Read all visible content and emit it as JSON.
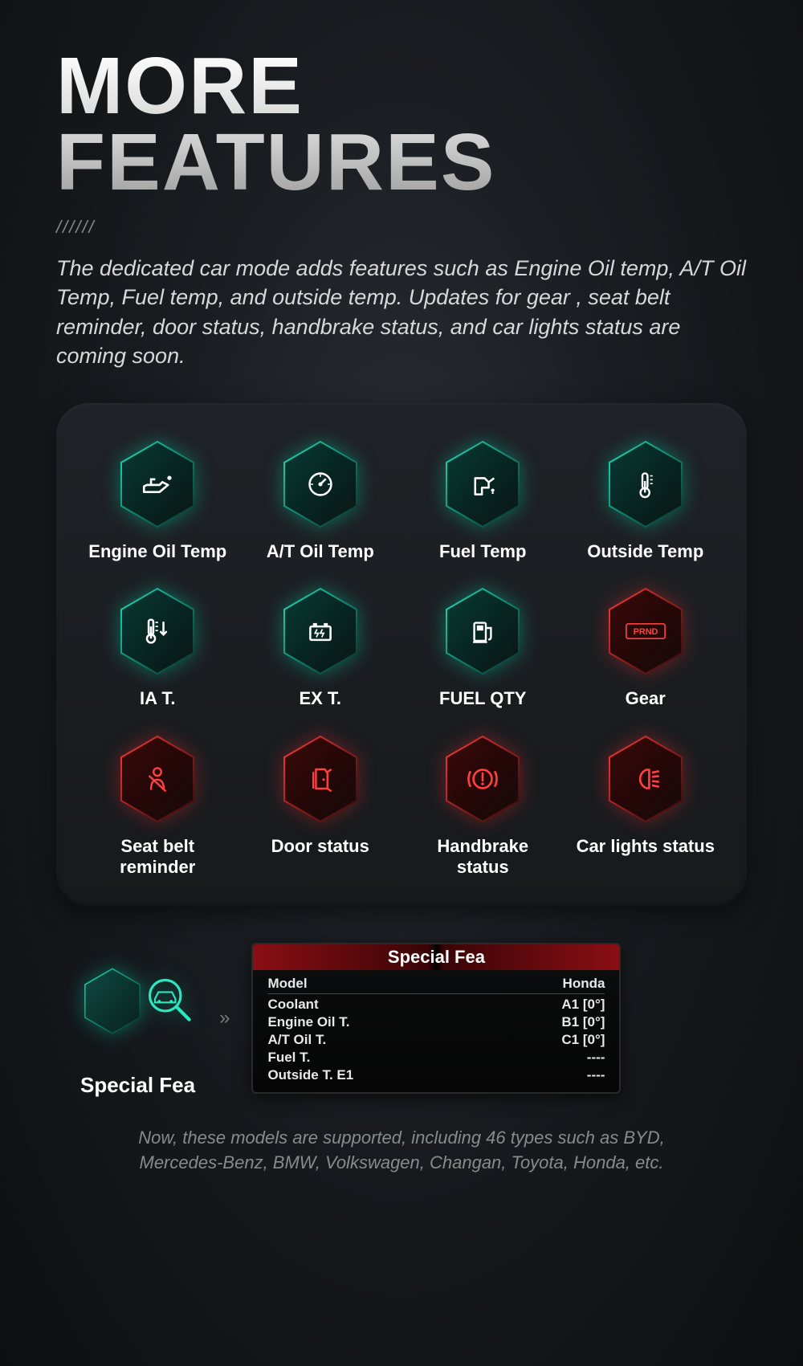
{
  "title_line1": "MORE",
  "title_line2": "FEATURES",
  "slashes": "//////",
  "description": "The dedicated car mode adds features such as Engine Oil temp, A/T Oil Temp, Fuel temp, and outside temp. Updates for gear , seat belt reminder, door status, handbrake status, and car lights status are coming soon.",
  "tiles": [
    {
      "label": "Engine Oil Temp",
      "color": "teal",
      "icon": "oil-can"
    },
    {
      "label": "A/T Oil Temp",
      "color": "teal",
      "icon": "gauge"
    },
    {
      "label": "Fuel Temp",
      "color": "teal",
      "icon": "fuel-nozzle"
    },
    {
      "label": "Outside Temp",
      "color": "teal",
      "icon": "thermometer"
    },
    {
      "label": "IA T.",
      "color": "teal",
      "icon": "intake-temp"
    },
    {
      "label": "EX T.",
      "color": "teal",
      "icon": "battery-temp"
    },
    {
      "label": "FUEL QTY",
      "color": "teal",
      "icon": "fuel-pump"
    },
    {
      "label": "Gear",
      "color": "red",
      "icon": "prnd"
    },
    {
      "label": "Seat belt reminder",
      "color": "red",
      "icon": "seatbelt"
    },
    {
      "label": "Door status",
      "color": "red",
      "icon": "door"
    },
    {
      "label": "Handbrake status",
      "color": "red",
      "icon": "handbrake"
    },
    {
      "label": "Car lights status",
      "color": "red",
      "icon": "headlight"
    }
  ],
  "special": {
    "label": "Special Fea",
    "arrows": "»"
  },
  "device": {
    "title": "Special Fea",
    "header_left": "Model",
    "header_right": "Honda",
    "rows": [
      {
        "k": "Coolant",
        "v": "A1 [0°]"
      },
      {
        "k": "Engine Oil T.",
        "v": "B1 [0°]"
      },
      {
        "k": "A/T Oil T.",
        "v": "C1 [0°]"
      },
      {
        "k": "Fuel T.",
        "v": "----"
      },
      {
        "k": "Outside T. E1",
        "v": "----"
      }
    ]
  },
  "footnote": "Now, these models are supported, including 46 types such as BYD, Mercedes-Benz, BMW, Volkswagen, Changan, Toyota, Honda, etc."
}
